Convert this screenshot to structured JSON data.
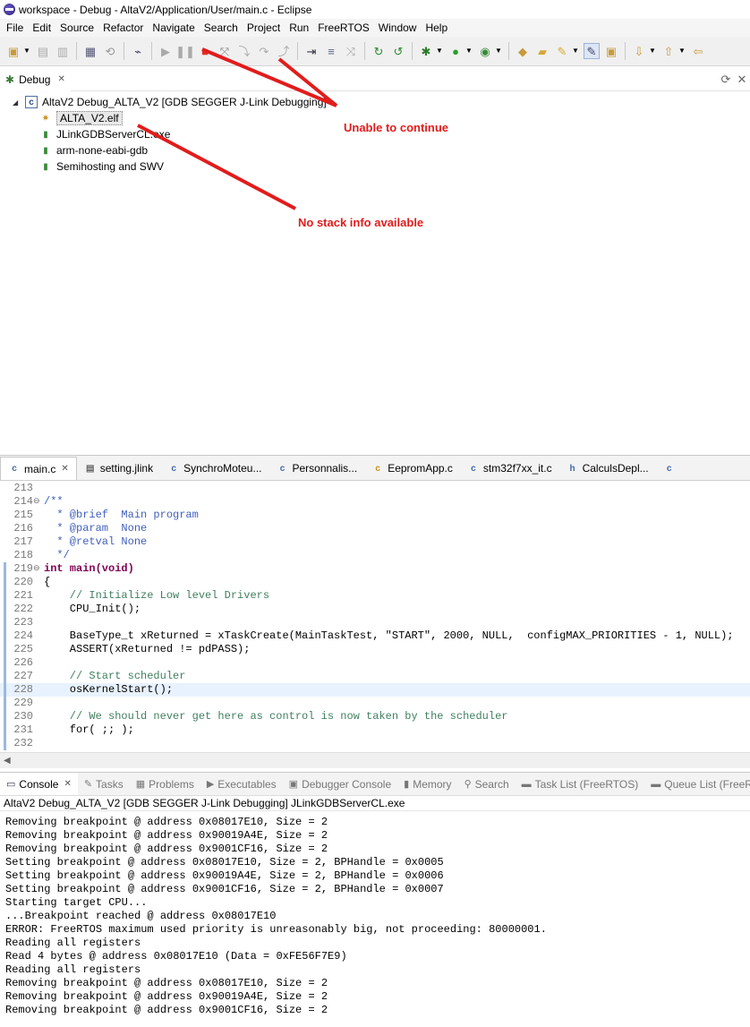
{
  "window": {
    "title": "workspace - Debug - AltaV2/Application/User/main.c - Eclipse"
  },
  "menu": [
    "File",
    "Edit",
    "Source",
    "Refactor",
    "Navigate",
    "Search",
    "Project",
    "Run",
    "FreeRTOS",
    "Window",
    "Help"
  ],
  "debug_view": {
    "tab_label": "Debug",
    "launch": "AltaV2 Debug_ALTA_V2 [GDB SEGGER J-Link Debugging]",
    "children": [
      "ALTA_V2.elf",
      "JLinkGDBServerCL.exe",
      "arm-none-eabi-gdb",
      "Semihosting and SWV"
    ]
  },
  "annotations": {
    "continue": "Unable to continue",
    "stack": "No stack info available"
  },
  "editor": {
    "tabs": [
      "main.c",
      "setting.jlink",
      "SynchroMoteu...",
      "Personnalis...",
      "EepromApp.c",
      "stm32f7xx_it.c",
      "CalculsDepl..."
    ],
    "lines": [
      {
        "n": "213",
        "t": ""
      },
      {
        "n": "214",
        "t": "/**"
      },
      {
        "n": "215",
        "t": "  * @brief  Main program"
      },
      {
        "n": "216",
        "t": "  * @param  None"
      },
      {
        "n": "217",
        "t": "  * @retval None"
      },
      {
        "n": "218",
        "t": "  */"
      },
      {
        "n": "219",
        "t": "int main(void)"
      },
      {
        "n": "220",
        "t": "{"
      },
      {
        "n": "221",
        "t": "    // Initialize Low level Drivers"
      },
      {
        "n": "222",
        "t": "    CPU_Init();"
      },
      {
        "n": "223",
        "t": ""
      },
      {
        "n": "224",
        "t": "    BaseType_t xReturned = xTaskCreate(MainTaskTest, \"START\", 2000, NULL,  configMAX_PRIORITIES - 1, NULL);"
      },
      {
        "n": "225",
        "t": "    ASSERT(xReturned != pdPASS);"
      },
      {
        "n": "226",
        "t": ""
      },
      {
        "n": "227",
        "t": "    // Start scheduler"
      },
      {
        "n": "228",
        "t": "    osKernelStart();"
      },
      {
        "n": "229",
        "t": ""
      },
      {
        "n": "230",
        "t": "    // We should never get here as control is now taken by the scheduler"
      },
      {
        "n": "231",
        "t": "    for( ;; );"
      },
      {
        "n": "232",
        "t": ""
      }
    ]
  },
  "console": {
    "tabs": [
      "Console",
      "Tasks",
      "Problems",
      "Executables",
      "Debugger Console",
      "Memory",
      "Search",
      "Task List (FreeRTOS)",
      "Queue List (FreeRTOS)"
    ],
    "source": "AltaV2 Debug_ALTA_V2 [GDB SEGGER J-Link Debugging] JLinkGDBServerCL.exe",
    "lines": [
      "Removing breakpoint @ address 0x08017E10, Size = 2",
      "Removing breakpoint @ address 0x90019A4E, Size = 2",
      "Removing breakpoint @ address 0x9001CF16, Size = 2",
      "Setting breakpoint @ address 0x08017E10, Size = 2, BPHandle = 0x0005",
      "Setting breakpoint @ address 0x90019A4E, Size = 2, BPHandle = 0x0006",
      "Setting breakpoint @ address 0x9001CF16, Size = 2, BPHandle = 0x0007",
      "Starting target CPU...",
      "...Breakpoint reached @ address 0x08017E10",
      "ERROR: FreeRTOS maximum used priority is unreasonably big, not proceeding: 80000001.",
      "Reading all registers",
      "Read 4 bytes @ address 0x08017E10 (Data = 0xFE56F7E9)",
      "Reading all registers",
      "Removing breakpoint @ address 0x08017E10, Size = 2",
      "Removing breakpoint @ address 0x90019A4E, Size = 2",
      "Removing breakpoint @ address 0x9001CF16, Size = 2"
    ]
  }
}
